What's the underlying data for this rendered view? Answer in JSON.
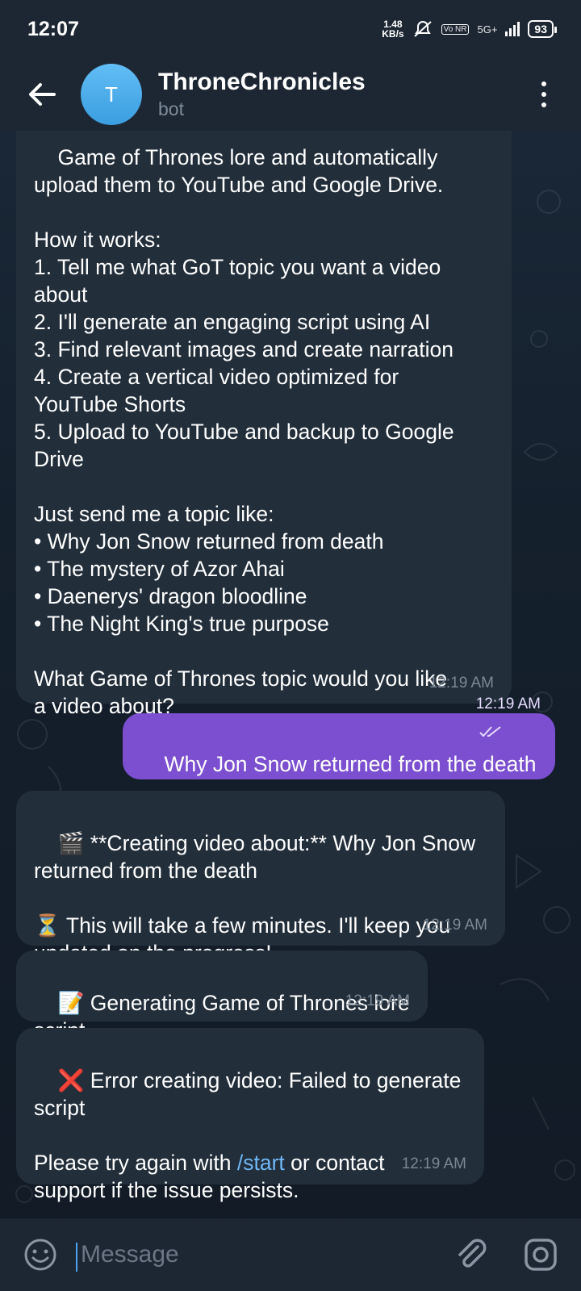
{
  "status_bar": {
    "time": "12:07",
    "net_speed_value": "1.48",
    "net_speed_unit": "KB/s",
    "volte": "Vo NR",
    "network": "5G+",
    "battery": "93"
  },
  "header": {
    "avatar_letter": "T",
    "title": "ThroneChronicles",
    "subtitle": "bot"
  },
  "messages": [
    {
      "direction": "in",
      "text": "Game of Thrones lore and automatically\nupload them to YouTube and Google Drive.\n\nHow it works:\n1. Tell me what GoT topic you want a video\nabout\n2. I'll generate an engaging script using AI\n3. Find relevant images and create narration\n4. Create a vertical video optimized for\nYouTube Shorts\n5. Upload to YouTube and backup to Google\nDrive\n\nJust send me a topic like:\n• Why Jon Snow returned from death\n• The mystery of Azor Ahai\n• Daenerys' dragon bloodline\n• The Night King's true purpose\n\nWhat Game of Thrones topic would you like\na video about?",
      "time": "12:19 AM"
    },
    {
      "direction": "out",
      "text": "Why Jon Snow returned from the death",
      "time": "12:19 AM"
    },
    {
      "direction": "in",
      "text": "🎬 **Creating video about:** Why Jon Snow\nreturned from the death\n\n⏳ This will take a few minutes. I'll keep you\nupdated on the progress!",
      "time": "12:19 AM"
    },
    {
      "direction": "in",
      "text": "📝 Generating Game of Thrones lore\nscript...",
      "time": "12:19 AM"
    },
    {
      "direction": "in",
      "text_before_link": "❌ Error creating video: Failed to generate\nscript\n\nPlease try again with ",
      "link": "/start",
      "text_after_link": " or contact\nsupport if the issue persists.",
      "time": "12:19 AM"
    }
  ],
  "composer": {
    "placeholder": "Message"
  },
  "icons": {
    "back": "arrow-left-icon",
    "menu": "more-vertical-icon",
    "emoji": "smile-icon",
    "attach": "paperclip-icon",
    "camera": "camera-icon",
    "read": "double-check-icon"
  },
  "colors": {
    "header_bg": "#1d2733",
    "incoming_bubble": "#222e3a",
    "outgoing_bubble": "#7b4fd0",
    "link": "#6fb7f7",
    "avatar": "#4aa8ea"
  }
}
